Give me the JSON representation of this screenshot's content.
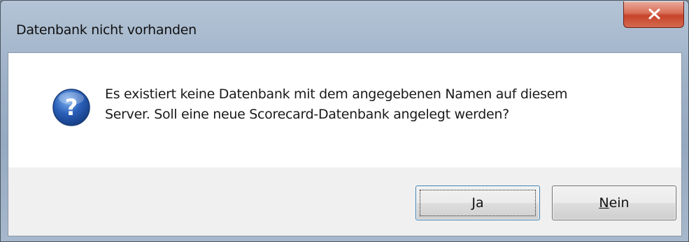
{
  "window": {
    "title": "Datenbank nicht vorhanden",
    "close_icon": "close-x-icon"
  },
  "dialog": {
    "icon": "question-icon",
    "message_line1": "Es existiert keine Datenbank mit dem angegebenen Namen auf diesem",
    "message_line2": "Server. Soll eine neue Scorecard-Datenbank angelegt werden?"
  },
  "buttons": {
    "yes_mnemonic": "J",
    "yes_rest": "a",
    "no_mnemonic": "N",
    "no_rest": "ein"
  },
  "colors": {
    "close_button": "#d2533a",
    "question_icon": "#2a5fb8",
    "focus_border": "#3c7fb1"
  }
}
